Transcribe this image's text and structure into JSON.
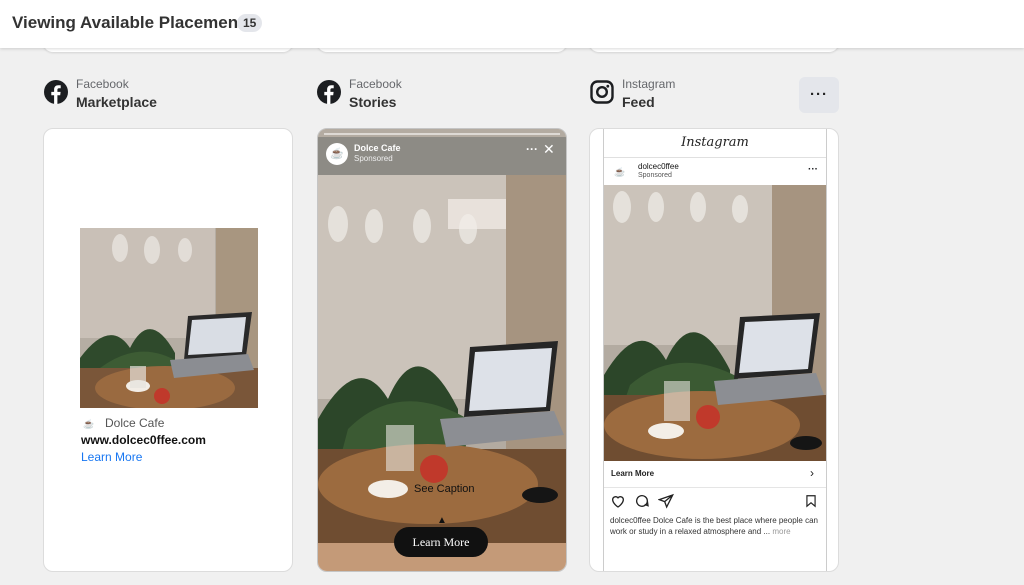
{
  "header": {
    "title": "Viewing Available Placements",
    "count": "15"
  },
  "placements": [
    {
      "platform": "Facebook",
      "name": "Marketplace"
    },
    {
      "platform": "Facebook",
      "name": "Stories"
    },
    {
      "platform": "Instagram",
      "name": "Feed"
    }
  ],
  "more_button": {
    "label": "···"
  },
  "marketplace": {
    "brand": "Dolce Cafe",
    "url": "www.dolcec0ffee.com",
    "link": "Learn More"
  },
  "stories": {
    "name": "Dolce Cafe",
    "sponsored": "Sponsored",
    "caption": "See Caption",
    "cta": "Learn More",
    "dots": "···",
    "close": "✕"
  },
  "instagram": {
    "logo": "Instagram",
    "username": "dolcec0ffee",
    "sponsored": "Sponsored",
    "learn_more": "Learn More",
    "caption_user": "dolcec0ffee",
    "caption": "Dolce Cafe is the best place where people can work or study in a relaxed atmosphere and ...",
    "more": "more"
  },
  "colors": {
    "link": "#1877f2",
    "badge_bg": "#e4e6eb",
    "story_cta": "#111111"
  }
}
